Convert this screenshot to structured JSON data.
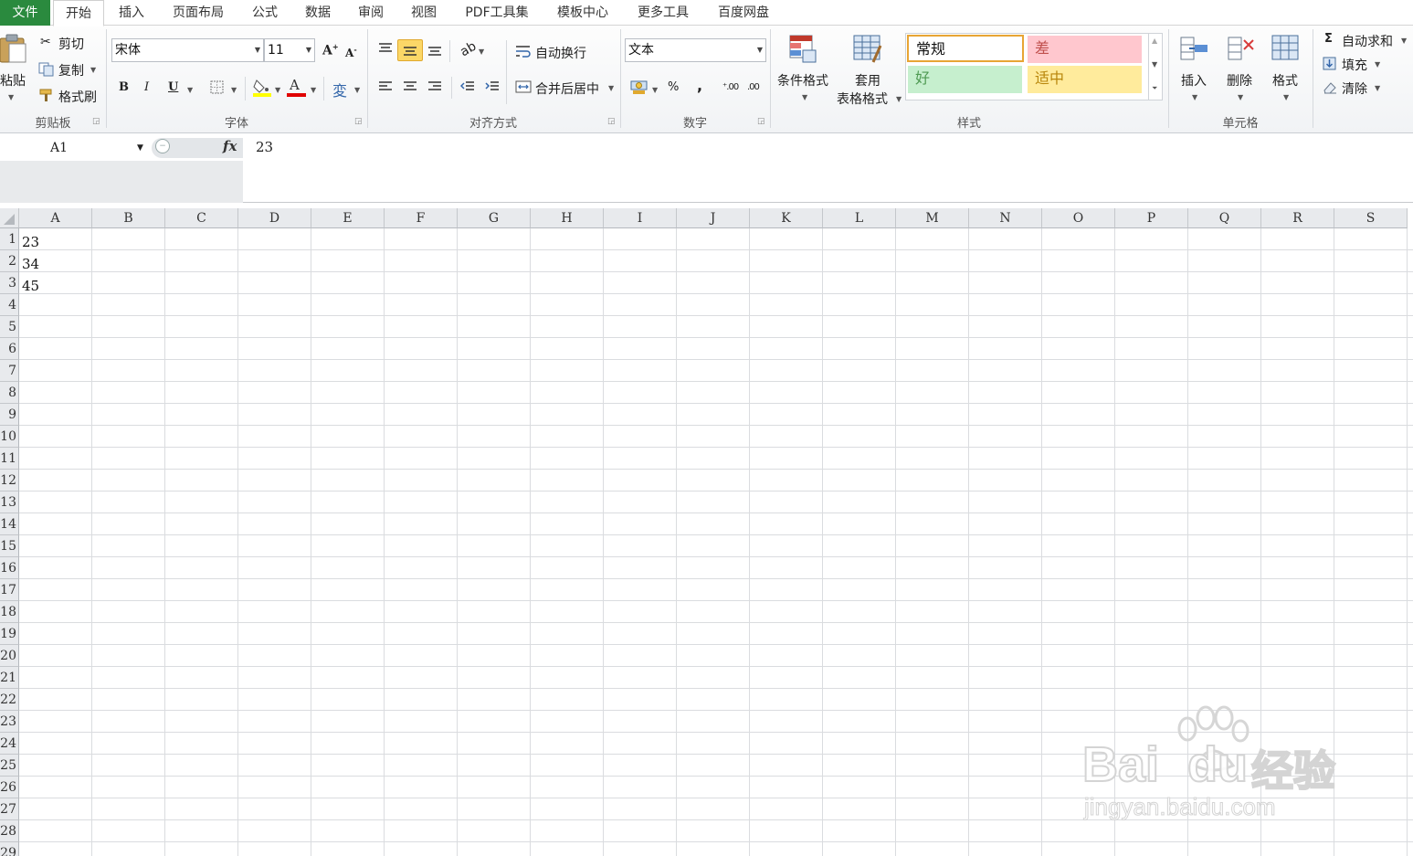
{
  "menu": {
    "file": "文件",
    "tabs": [
      "开始",
      "插入",
      "页面布局",
      "公式",
      "数据",
      "审阅",
      "视图",
      "PDF工具集",
      "模板中心",
      "更多工具",
      "百度网盘"
    ]
  },
  "clipboard": {
    "paste": "粘贴",
    "cut": "剪切",
    "copy": "复制",
    "format_painter": "格式刷",
    "label": "剪贴板"
  },
  "font": {
    "name": "宋体",
    "size": "11",
    "bold": "B",
    "italic": "I",
    "underline": "U",
    "font_color_letter": "A",
    "label": "字体"
  },
  "alignment": {
    "wrap_text": "自动换行",
    "merge_center": "合并后居中",
    "label": "对齐方式"
  },
  "number": {
    "format": "文本",
    "percent": "%",
    "comma": ",",
    "label": "数字"
  },
  "styles": {
    "conditional_format": "条件格式",
    "table_format_line1": "套用",
    "table_format_line2": "表格格式",
    "normal": "常规",
    "bad": "差",
    "good": "好",
    "neutral": "适中",
    "label": "样式",
    "colors": {
      "bad_bg": "#ffc7ce",
      "bad_fg": "#c0504d",
      "good_bg": "#c6efce",
      "good_fg": "#4e9a52",
      "neutral_bg": "#ffeb9c",
      "neutral_fg": "#b8860b"
    }
  },
  "cells_group": {
    "insert": "插入",
    "delete": "删除",
    "format": "格式",
    "label": "单元格"
  },
  "editing": {
    "autosum": "自动求和",
    "fill": "填充",
    "clear": "清除"
  },
  "formula_bar": {
    "name_box": "A1",
    "fx": "fx",
    "value": "23"
  },
  "sheet": {
    "columns": [
      "A",
      "B",
      "C",
      "D",
      "E",
      "F",
      "G",
      "H",
      "I",
      "J",
      "K",
      "L",
      "M",
      "N",
      "O",
      "P",
      "Q",
      "R",
      "S"
    ],
    "rows": [
      "1",
      "2",
      "3",
      "4",
      "5",
      "6",
      "7",
      "8",
      "9",
      "10",
      "11",
      "12",
      "13",
      "14",
      "15",
      "16",
      "17",
      "18",
      "19",
      "20",
      "21",
      "22",
      "23",
      "24",
      "25",
      "26",
      "27",
      "28",
      "29"
    ],
    "values": [
      "23",
      "34",
      "45"
    ]
  },
  "watermark": {
    "brand": "Bai",
    "brand2": "du",
    "cn": "经验",
    "url": "jingyan.baidu.com"
  }
}
